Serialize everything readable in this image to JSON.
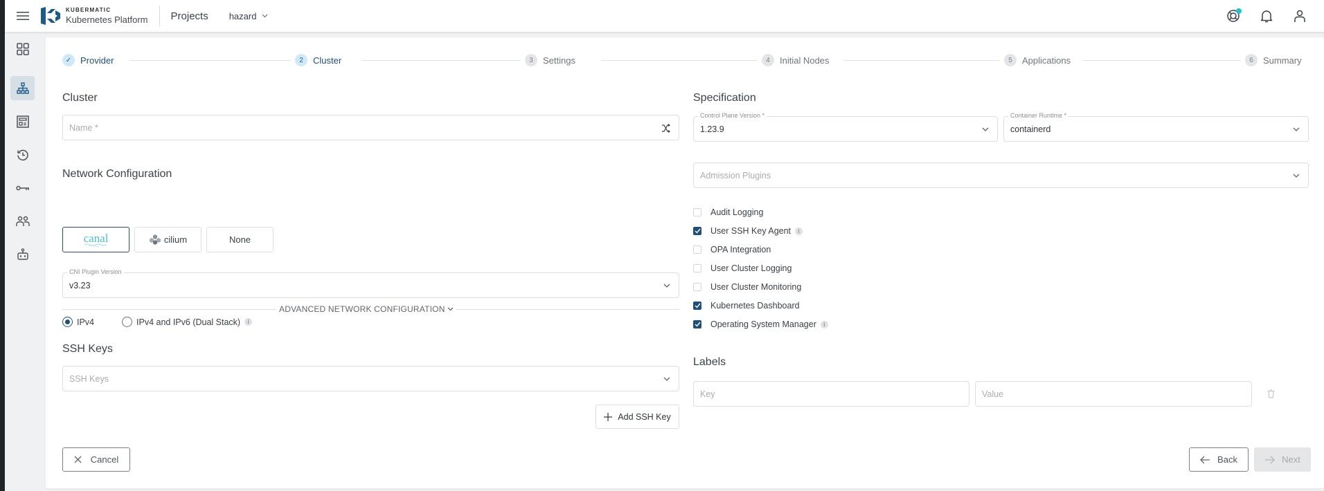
{
  "header": {
    "logo_top": "KUBERMATIC",
    "logo_bottom": "Kubernetes Platform",
    "projects_label": "Projects",
    "project_selected": "hazard",
    "icons": [
      "menu-icon",
      "help-lifebuoy-icon",
      "bell-icon",
      "user-icon"
    ],
    "notification_color": "#1fc3c8"
  },
  "sidebar": {
    "items": [
      {
        "name": "dashboard",
        "icon": "grid-icon",
        "active": false
      },
      {
        "name": "clusters",
        "icon": "cluster-tree-icon",
        "active": true
      },
      {
        "name": "cluster-templates",
        "icon": "template-icon",
        "active": false
      },
      {
        "name": "backups",
        "icon": "history-icon",
        "active": false
      },
      {
        "name": "ssh-keys",
        "icon": "key-icon",
        "active": false
      },
      {
        "name": "members",
        "icon": "members-icon",
        "active": false
      },
      {
        "name": "service-accounts",
        "icon": "robot-icon",
        "active": false
      }
    ]
  },
  "stepper": {
    "steps": [
      {
        "number": "✓",
        "label": "Provider",
        "state": "done"
      },
      {
        "number": "2",
        "label": "Cluster",
        "state": "current"
      },
      {
        "number": "3",
        "label": "Settings",
        "state": "todo"
      },
      {
        "number": "4",
        "label": "Initial Nodes",
        "state": "todo"
      },
      {
        "number": "5",
        "label": "Applications",
        "state": "todo"
      },
      {
        "number": "6",
        "label": "Summary",
        "state": "todo"
      }
    ]
  },
  "cluster": {
    "title": "Cluster",
    "name_placeholder": "Name *",
    "name_value": ""
  },
  "network": {
    "title": "Network Configuration",
    "cni_options": [
      {
        "label": "canal",
        "selected": true
      },
      {
        "label": "cilium",
        "selected": false
      },
      {
        "label": "None",
        "selected": false
      }
    ],
    "cni_version_label": "CNI Plugin Version",
    "cni_version_value": "v3.23",
    "ip_options": [
      {
        "label": "IPv4",
        "checked": true
      },
      {
        "label": "IPv4 and IPv6 (Dual Stack)",
        "checked": false,
        "info": true
      }
    ],
    "advanced_label": "ADVANCED NETWORK CONFIGURATION"
  },
  "ssh": {
    "title": "SSH Keys",
    "placeholder": "SSH Keys",
    "add_label": "Add SSH Key"
  },
  "specification": {
    "title": "Specification",
    "control_plane_label": "Control Plane Version *",
    "control_plane_value": "1.23.9",
    "runtime_label": "Container Runtime *",
    "runtime_value": "containerd",
    "admission_placeholder": "Admission Plugins",
    "features": [
      {
        "label": "Audit Logging",
        "checked": false,
        "info": false
      },
      {
        "label": "User SSH Key Agent",
        "checked": true,
        "info": true
      },
      {
        "label": "OPA Integration",
        "checked": false,
        "info": false
      },
      {
        "label": "User Cluster Logging",
        "checked": false,
        "info": false
      },
      {
        "label": "User Cluster Monitoring",
        "checked": false,
        "info": false
      },
      {
        "label": "Kubernetes Dashboard",
        "checked": true,
        "info": false
      },
      {
        "label": "Operating System Manager",
        "checked": true,
        "info": true
      }
    ]
  },
  "labels": {
    "title": "Labels",
    "key_placeholder": "Key",
    "value_placeholder": "Value"
  },
  "footer": {
    "cancel_label": "Cancel",
    "back_label": "Back",
    "next_label": "Next"
  },
  "colors": {
    "primary": "#1f4f7a",
    "step_active_bg": "#cfe9f7",
    "canal": "#4fc0d6"
  }
}
